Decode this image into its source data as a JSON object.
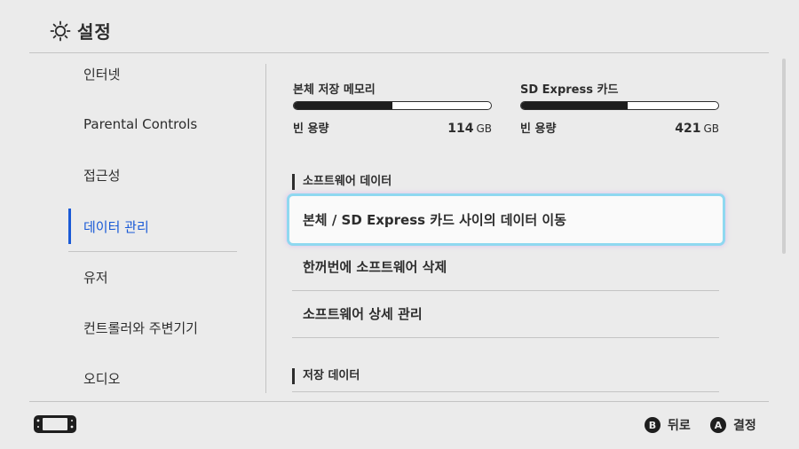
{
  "header": {
    "title": "설정",
    "icon": "sun-icon"
  },
  "sidebar": {
    "items": [
      {
        "label": "인터넷"
      },
      {
        "label": "Parental Controls"
      },
      {
        "label": "접근성"
      },
      {
        "label": "데이터 관리"
      },
      {
        "label": "유저"
      },
      {
        "label": "컨트롤러와 주변기기"
      },
      {
        "label": "오디오"
      }
    ],
    "active_index": 3,
    "accent_color": "#1a5ad6"
  },
  "storage": {
    "internal": {
      "name": "본체 저장 메모리",
      "free_label": "빈 용량",
      "free_value": "114",
      "unit": "GB",
      "used_fraction": 0.5
    },
    "sd": {
      "name": "SD Express 카드",
      "free_label": "빈 용량",
      "free_value": "421",
      "unit": "GB",
      "used_fraction": 0.54
    }
  },
  "software_section": {
    "title": "소프트웨어 데이터",
    "items": [
      {
        "label": "본체 / SD Express 카드 사이의 데이터 이동"
      },
      {
        "label": "한꺼번에 소프트웨어 삭제"
      },
      {
        "label": "소프트웨어 상세 관리"
      }
    ],
    "selected_index": 0
  },
  "save_section": {
    "title": "저장 데이터"
  },
  "footer": {
    "console_icon": "switch-console-icon",
    "back": {
      "key": "B",
      "label": "뒤로"
    },
    "confirm": {
      "key": "A",
      "label": "결정"
    }
  }
}
